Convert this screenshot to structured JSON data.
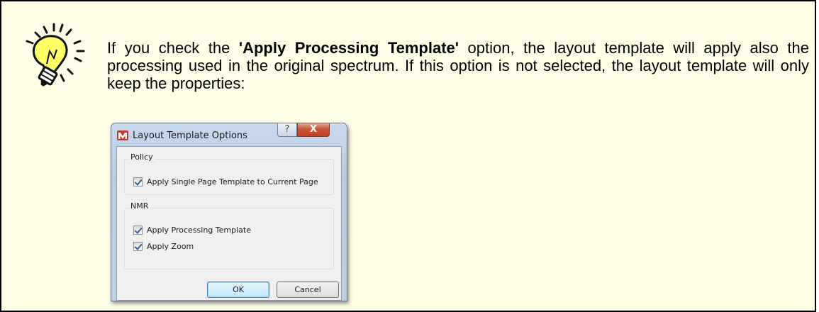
{
  "tip": {
    "text_before": "If you check the ",
    "bold_text": "'Apply Processing Template'",
    "text_after": " option, the layout template will apply also the processing used in the original spectrum. If this option is not selected, the layout template will only keep the properties:"
  },
  "icons": {
    "tip": "lightbulb-icon",
    "app": "mnova-app-icon",
    "help": "help-icon",
    "close": "close-icon"
  },
  "dialog": {
    "title": "Layout Template Options",
    "help_label": "?",
    "close_label": "X",
    "policy": {
      "label": "Policy",
      "options": [
        {
          "label": "Apply Single Page Template to Current Page",
          "checked": true
        }
      ]
    },
    "nmr": {
      "label": "NMR",
      "options": [
        {
          "label": "Apply Processing Template",
          "checked": true
        },
        {
          "label": "Apply Zoom",
          "checked": true
        }
      ]
    },
    "ok_label": "OK",
    "cancel_label": "Cancel"
  },
  "colors": {
    "tip_background": "#ffffe8",
    "bulb_yellow": "#ffff66",
    "close_red": "#c9553d"
  }
}
